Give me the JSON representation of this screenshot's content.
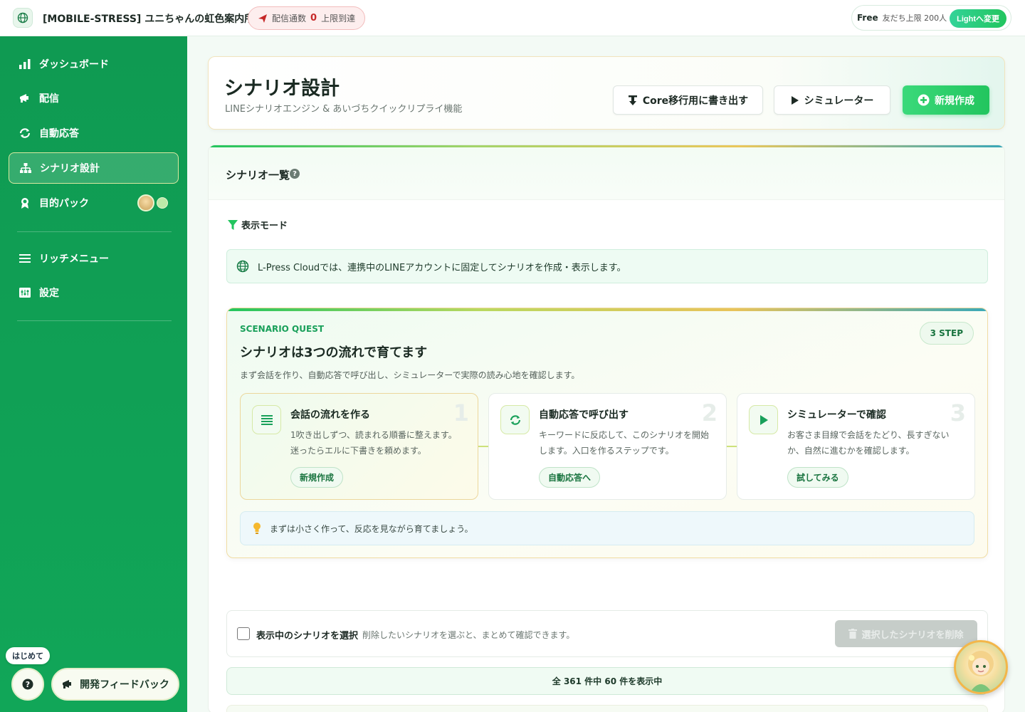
{
  "topbar": {
    "brand": "[MOBILE-STRESS] ユニちゃんの虹色案内所",
    "limit_label": "配信通数",
    "limit_count": "0",
    "limit_status": "上限到達",
    "plan_name": "Free",
    "plan_limit": "友だち上限 200人",
    "plan_button": "Lightへ変更"
  },
  "sidebar": {
    "items": [
      {
        "label": "ダッシュボード",
        "icon": "bar-chart-icon"
      },
      {
        "label": "配信",
        "icon": "megaphone-icon"
      },
      {
        "label": "自動応答",
        "icon": "sync-icon"
      },
      {
        "label": "シナリオ設計",
        "icon": "sitemap-icon",
        "active": true
      },
      {
        "label": "目的パック",
        "icon": "award-icon"
      },
      {
        "label": "リッチメニュー",
        "icon": "menu-icon"
      },
      {
        "label": "設定",
        "icon": "settings-icon"
      }
    ],
    "hajime_label": "はじめて",
    "feedback_label": "開発フィードバック"
  },
  "header": {
    "title": "シナリオ設計",
    "subtitle": "LINEシナリオエンジン & あいづちクイックリプライ機能",
    "export_button": "Core移行用に書き出す",
    "simulator_button": "シミュレーター",
    "new_button": "新規作成"
  },
  "main": {
    "list_title": "シナリオ一覧",
    "mode_label": "表示モード",
    "info_text": "L-Press Cloudでは、連携中のLINEアカウントに固定してシナリオを作成・表示します。",
    "quest": {
      "eyebrow": "SCENARIO QUEST",
      "title": "シナリオは3つの流れで育てます",
      "description": "まず会話を作り、自動応答で呼び出し、シミュレーターで実際の読み心地を確認します。",
      "badge": "3 STEP",
      "steps": [
        {
          "num": "1",
          "title": "会話の流れを作る",
          "desc": "1吹き出しずつ、読まれる順番に整えます。迷ったらエルに下書きを頼めます。",
          "button": "新規作成",
          "icon": "list-icon"
        },
        {
          "num": "2",
          "title": "自動応答で呼び出す",
          "desc": "キーワードに反応して、このシナリオを開始します。入口を作るステップです。",
          "button": "自動応答へ",
          "icon": "sync-icon"
        },
        {
          "num": "3",
          "title": "シミュレーターで確認",
          "desc": "お客さま目線で会話をたどり、長すぎないか、自然に進むかを確認します。",
          "button": "試してみる",
          "icon": "play-icon"
        }
      ],
      "tip": "まずは小さく作って、反応を見ながら育てましょう。"
    },
    "select_label": "表示中のシナリオを選択",
    "select_hint": "削除したいシナリオを選ぶと、まとめて確認できます。",
    "delete_button": "選択したシナリオを削除",
    "count_text": "全 361 件中 60 件を表示中"
  },
  "colors": {
    "brand_green": "#11a658",
    "accent_green": "#22c55e",
    "limit_red": "#c62828"
  }
}
